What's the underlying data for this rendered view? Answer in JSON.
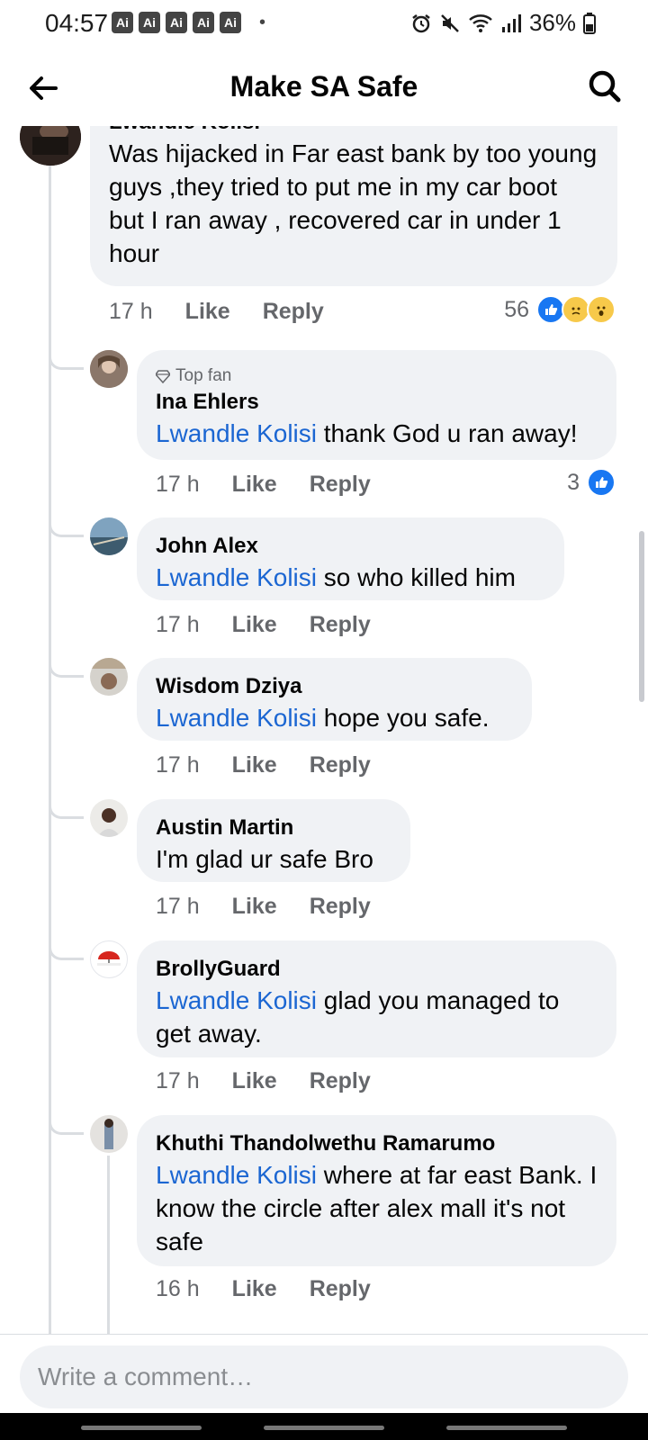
{
  "status_bar": {
    "time": "04:57",
    "ai_badges": [
      "Ai",
      "Ai",
      "Ai",
      "Ai",
      "Ai"
    ],
    "dot": "•",
    "battery": "36%",
    "icons": [
      "alarm-icon",
      "mute-icon",
      "wifi-icon",
      "signal-icon",
      "battery-icon"
    ]
  },
  "header": {
    "title": "Make SA Safe",
    "back_icon": "arrow-left-icon",
    "search_icon": "search-icon"
  },
  "parent_comment": {
    "name": "Lwandle Kolisi",
    "text": "Was hijacked in Far east bank  by too young guys ,they tried to put me in my car boot but I ran away , recovered car in under 1 hour",
    "time": "17 h",
    "like": "Like",
    "reply": "Reply",
    "reaction_count": "56",
    "reactions": [
      "like",
      "sad",
      "wow"
    ]
  },
  "replies": [
    {
      "badge": "Top fan",
      "name": "Ina Ehlers",
      "mention": "Lwandle Kolisi",
      "text": " thank God u ran away!",
      "time": "17 h",
      "like": "Like",
      "reply": "Reply",
      "reaction_count": "3"
    },
    {
      "name": "John Alex",
      "mention": "Lwandle Kolisi",
      "text": " so who killed him",
      "time": "17 h",
      "like": "Like",
      "reply": "Reply"
    },
    {
      "name": "Wisdom Dziya",
      "mention": "Lwandle Kolisi",
      "text": " hope you safe.",
      "time": "17 h",
      "like": "Like",
      "reply": "Reply"
    },
    {
      "name": "Austin Martin",
      "text": "I'm glad ur safe Bro",
      "time": "17 h",
      "like": "Like",
      "reply": "Reply"
    },
    {
      "name": "BrollyGuard",
      "mention": "Lwandle Kolisi",
      "text": " glad you managed to get away.",
      "time": "17 h",
      "like": "Like",
      "reply": "Reply"
    },
    {
      "name": "Khuthi Thandolwethu Ramarumo",
      "mention": "Lwandle Kolisi",
      "text": " where at far east Bank. I know the circle after alex mall it's not safe",
      "time": "16 h",
      "like": "Like",
      "reply": "Reply"
    }
  ],
  "composer": {
    "placeholder": "Write a comment…"
  },
  "colors": {
    "accent": "#1b66d2",
    "bubble": "#f0f2f5",
    "like_blue": "#1877f2",
    "muted": "#65676b"
  }
}
